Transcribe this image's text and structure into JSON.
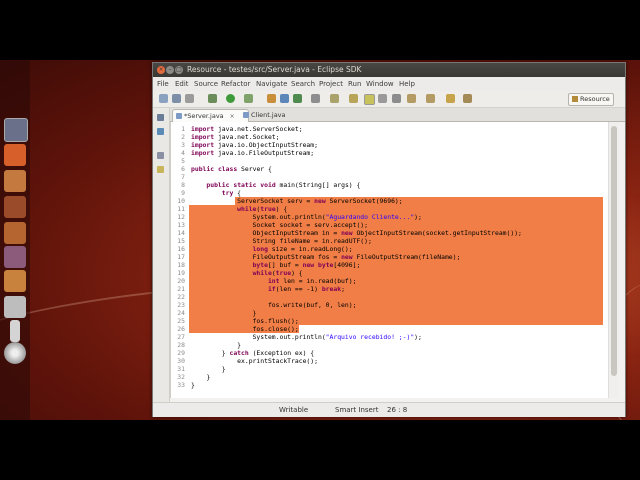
{
  "window": {
    "title": "Resource - testes/src/Server.java - Eclipse SDK"
  },
  "menu": [
    "File",
    "Edit",
    "Source",
    "Refactor",
    "Navigate",
    "Search",
    "Project",
    "Run",
    "Window",
    "Help"
  ],
  "toolbar": {
    "perspective_label": "Resource"
  },
  "tabs": [
    {
      "label": "*Server.java",
      "active": true
    },
    {
      "label": "Client.java",
      "active": false
    }
  ],
  "code_lines": [
    {
      "n": "1",
      "text": "import java.net.ServerSocket;",
      "sel": "none"
    },
    {
      "n": "2",
      "text": "import java.net.Socket;",
      "sel": "none"
    },
    {
      "n": "3",
      "text": "import java.io.ObjectInputStream;",
      "sel": "none"
    },
    {
      "n": "4",
      "text": "import java.io.FileOutputStream;",
      "sel": "none"
    },
    {
      "n": "5",
      "text": "",
      "sel": "none"
    },
    {
      "n": "6",
      "text": "public class Server {",
      "sel": "none"
    },
    {
      "n": "7",
      "text": "",
      "sel": "none"
    },
    {
      "n": "8",
      "text": "    public static void main(String[] args) {",
      "sel": "none"
    },
    {
      "n": "9",
      "text": "        try {",
      "sel": "none"
    },
    {
      "n": "10",
      "text": "            ServerSocket serv = new ServerSocket(9696);",
      "sel": "partial"
    },
    {
      "n": "11",
      "text": "            while(true) {",
      "sel": "full"
    },
    {
      "n": "12",
      "text": "                System.out.println(\"Aguardando Cliente...\");",
      "sel": "full"
    },
    {
      "n": "13",
      "text": "                Socket socket = serv.accept();",
      "sel": "full"
    },
    {
      "n": "14",
      "text": "                ObjectInputStream in = new ObjectInputStream(socket.getInputStream());",
      "sel": "full"
    },
    {
      "n": "15",
      "text": "                String fileName = in.readUTF();",
      "sel": "full"
    },
    {
      "n": "16",
      "text": "                long size = in.readLong();",
      "sel": "full"
    },
    {
      "n": "17",
      "text": "                FileOutputStream fos = new FileOutputStream(fileName);",
      "sel": "full"
    },
    {
      "n": "18",
      "text": "                byte[] buf = new byte[4096];",
      "sel": "full"
    },
    {
      "n": "19",
      "text": "                while(true) {",
      "sel": "full"
    },
    {
      "n": "20",
      "text": "                    int len = in.read(buf);",
      "sel": "full"
    },
    {
      "n": "21",
      "text": "                    if(len == -1) break;",
      "sel": "full"
    },
    {
      "n": "22",
      "text": "",
      "sel": "full"
    },
    {
      "n": "23",
      "text": "                    fos.write(buf, 0, len);",
      "sel": "full"
    },
    {
      "n": "24",
      "text": "                }",
      "sel": "full"
    },
    {
      "n": "25",
      "text": "                fos.flush();",
      "sel": "full"
    },
    {
      "n": "26",
      "text": "                fos.close();",
      "sel": "end"
    },
    {
      "n": "27",
      "text": "                System.out.println(\"Arquivo recebido! ;-)\");",
      "sel": "none"
    },
    {
      "n": "28",
      "text": "            }",
      "sel": "none"
    },
    {
      "n": "29",
      "text": "        } catch (Exception ex) {",
      "sel": "none"
    },
    {
      "n": "30",
      "text": "            ex.printStackTrace();",
      "sel": "none"
    },
    {
      "n": "31",
      "text": "        }",
      "sel": "none"
    },
    {
      "n": "32",
      "text": "    }",
      "sel": "none"
    },
    {
      "n": "33",
      "text": "}",
      "sel": "none"
    }
  ],
  "status": {
    "mode": "Writable",
    "insert": "Smart Insert",
    "position": "26 : 8"
  },
  "colors": {
    "selection": "#f07e46",
    "keyword": "#7f0055",
    "string": "#2a00ff"
  }
}
